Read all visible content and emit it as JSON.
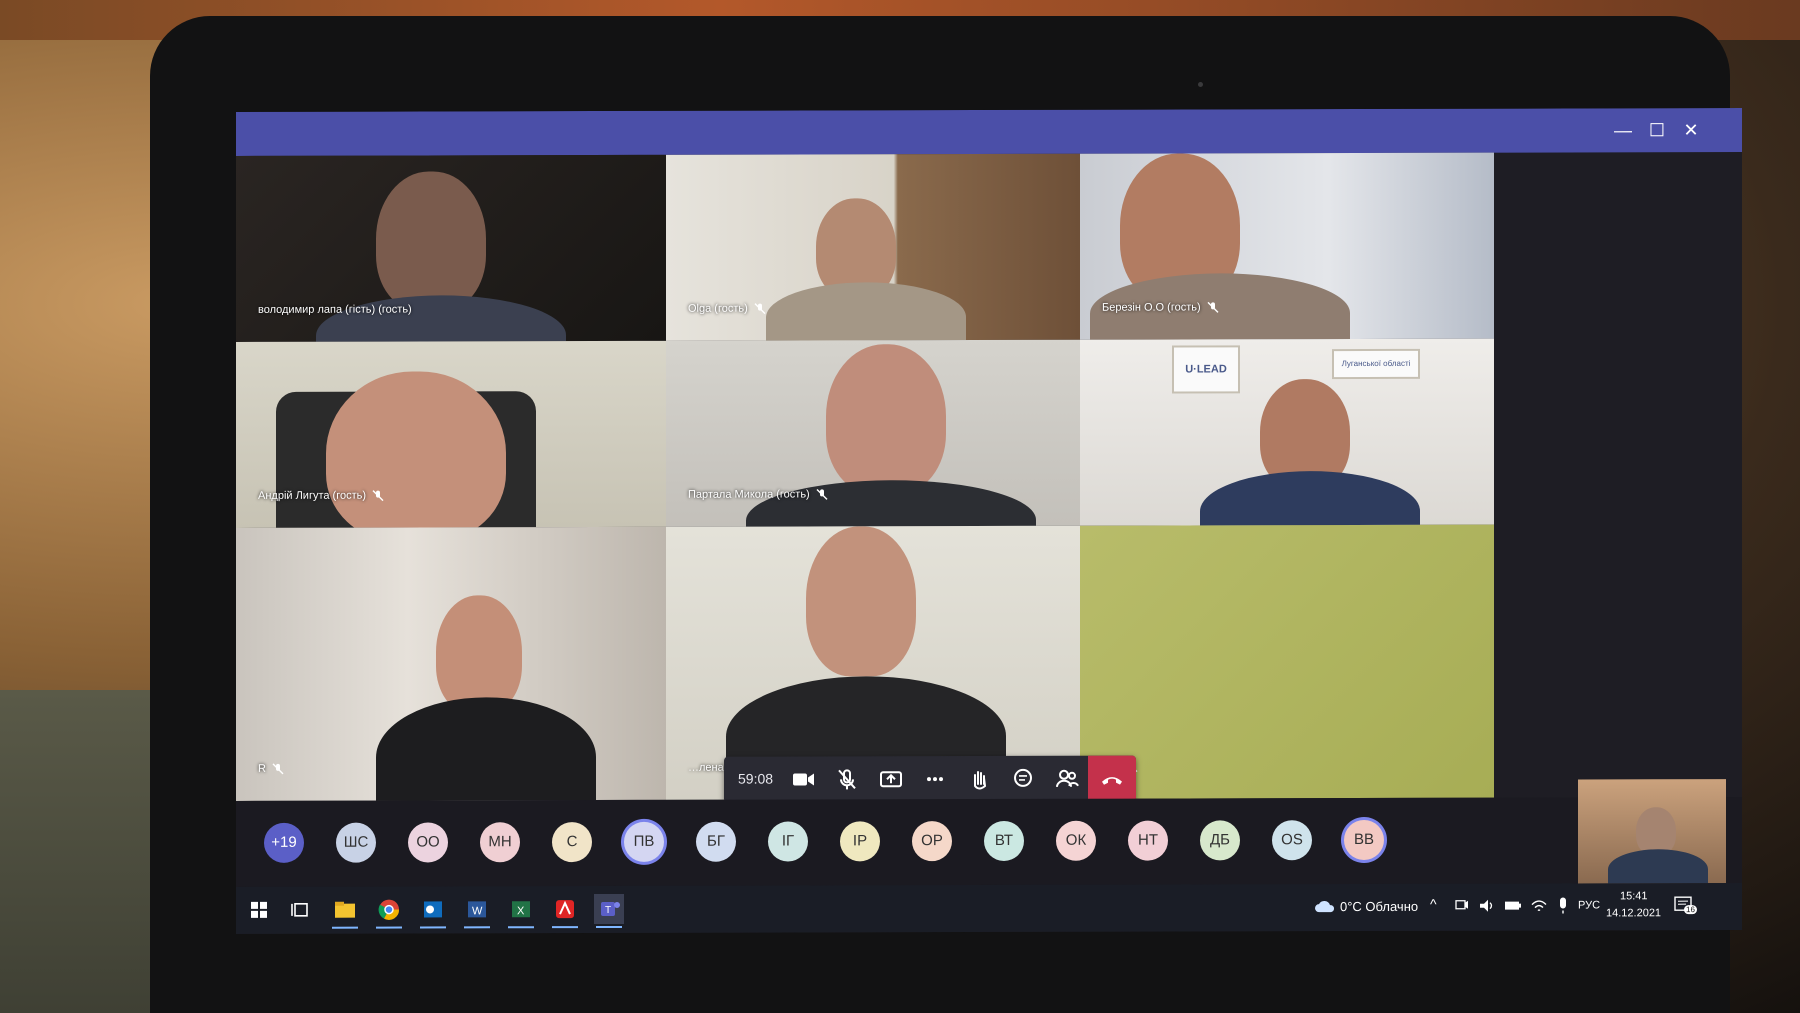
{
  "window": {
    "controls": {
      "minimize": "—",
      "maximize": "☐",
      "close": "✕"
    }
  },
  "participants": [
    {
      "name": "володимир лапа (гість) (гость)",
      "muted": false
    },
    {
      "name": "Olga (гость)",
      "muted": true
    },
    {
      "name": "Березін О.О (гость)",
      "muted": true
    },
    {
      "name": "Андрій Лигута (гость)",
      "muted": true
    },
    {
      "name": "Партала Микола (гость)",
      "muted": true
    },
    {
      "name": "",
      "muted": false,
      "wall_sign_1": "U·LEAD",
      "wall_sign_2": "Луганської області"
    },
    {
      "name": "R",
      "muted": true
    },
    {
      "name": "…лена (Шиловодська…) (гость)",
      "muted": true
    },
    {
      "name": "",
      "muted": true
    }
  ],
  "meeting_controls": {
    "timer": "59:08",
    "buttons": [
      "camera",
      "mic-off",
      "share",
      "more",
      "raise-hand",
      "chat",
      "participants",
      "hang-up"
    ]
  },
  "overflow_count": "+19",
  "avatars": [
    {
      "initials": "ШС",
      "color": "#c8d2e6"
    },
    {
      "initials": "ОО",
      "color": "#ecd3df"
    },
    {
      "initials": "МН",
      "color": "#f0cfd3"
    },
    {
      "initials": "С",
      "color": "#f1e4c8"
    },
    {
      "initials": "ПВ",
      "color": "#d4d6f2"
    },
    {
      "initials": "БГ",
      "color": "#d1dcf0"
    },
    {
      "initials": "ІГ",
      "color": "#cfe6e4"
    },
    {
      "initials": "ІР",
      "color": "#efe8bf"
    },
    {
      "initials": "ОР",
      "color": "#f5d8c9"
    },
    {
      "initials": "ВТ",
      "color": "#cbe8e2"
    },
    {
      "initials": "ОК",
      "color": "#f5d4d4"
    },
    {
      "initials": "НТ",
      "color": "#f2cfd6"
    },
    {
      "initials": "ДБ",
      "color": "#d7e8cc"
    },
    {
      "initials": "OS",
      "color": "#cfe3ec"
    },
    {
      "initials": "ВВ",
      "color": "#f3c9c3"
    }
  ],
  "taskbar": {
    "weather": "0°C Облачно",
    "language": "РУС",
    "time": "15:41",
    "date": "14.12.2021",
    "notifications": "16"
  },
  "colors": {
    "teams_purple": "#4b4fa8",
    "hangup_red": "#c4314b",
    "overflow_badge": "#5b5fc7"
  }
}
